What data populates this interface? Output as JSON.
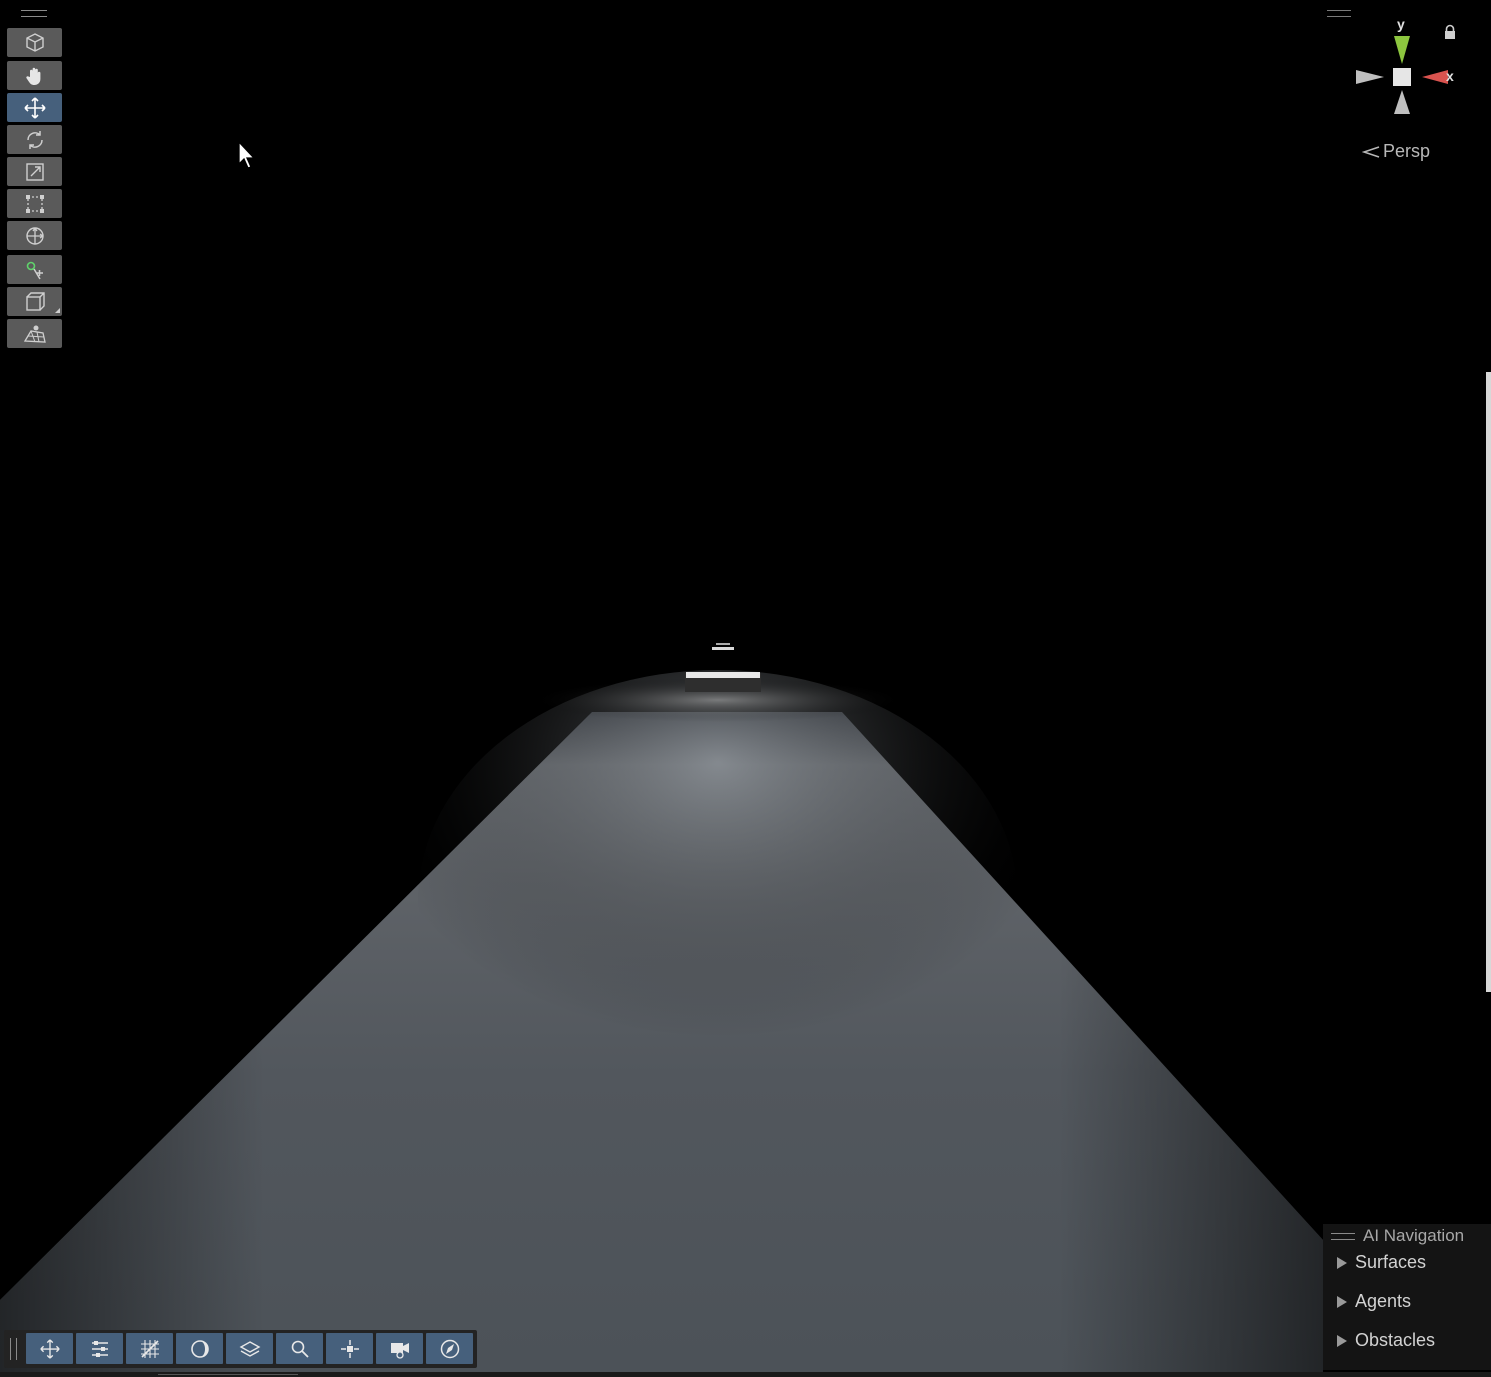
{
  "scene_view": {
    "camera_mode": "Persp",
    "gizmo_axes": {
      "y": "y",
      "x": "x"
    },
    "colors": {
      "y_axis": "#8dc63f",
      "x_axis": "#d9534f",
      "neutral_axis": "#bfbfbf",
      "active_tool": "#46607c",
      "tool_bg": "#5a5a5a"
    }
  },
  "tools": [
    {
      "icon": "cube-icon",
      "active": false
    },
    {
      "icon": "hand-icon",
      "active": false
    },
    {
      "icon": "move-icon",
      "active": true
    },
    {
      "icon": "rotate-icon",
      "active": false
    },
    {
      "icon": "scale-icon",
      "active": false
    },
    {
      "icon": "rect-transform-icon",
      "active": false
    },
    {
      "icon": "transform-icon",
      "active": false
    },
    {
      "icon": "custom-tool-icon",
      "active": false
    },
    {
      "icon": "box-volume-icon",
      "active": false
    },
    {
      "icon": "navmesh-tool-icon",
      "active": false
    }
  ],
  "ai_navigation": {
    "title": "AI Navigation",
    "items": [
      {
        "label": "Surfaces"
      },
      {
        "label": "Agents"
      },
      {
        "label": "Obstacles"
      }
    ]
  },
  "bottom_toolbar": [
    {
      "icon": "move-icon"
    },
    {
      "icon": "sliders-icon"
    },
    {
      "icon": "grid-icon"
    },
    {
      "icon": "shading-icon"
    },
    {
      "icon": "layers-icon"
    },
    {
      "icon": "search-icon"
    },
    {
      "icon": "pivot-icon"
    },
    {
      "icon": "camera-icon"
    },
    {
      "icon": "compass-icon"
    }
  ]
}
